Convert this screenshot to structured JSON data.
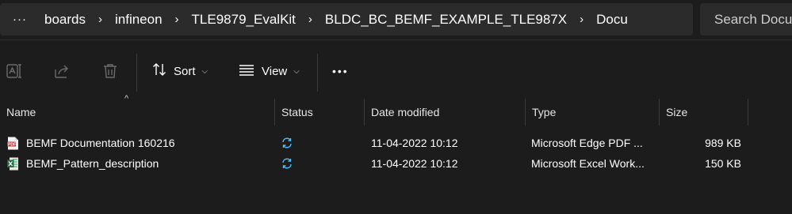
{
  "address_bar": {
    "more_label": "···",
    "breadcrumbs": [
      "boards",
      "infineon",
      "TLE9879_EvalKit",
      "BLDC_BC_BEMF_EXAMPLE_TLE987X",
      "Docu"
    ],
    "separator": "›",
    "search_placeholder": "Search Docu"
  },
  "toolbar": {
    "rename_icon": "rename-icon",
    "share_icon": "share-icon",
    "delete_icon": "trash-icon",
    "sort_label": "Sort",
    "view_label": "View",
    "more_label": "•••"
  },
  "columns": {
    "name": "Name",
    "status": "Status",
    "date_modified": "Date modified",
    "type": "Type",
    "size": "Size"
  },
  "files": [
    {
      "name": "BEMF Documentation 160216",
      "icon": "pdf-file-icon",
      "status_icon": "sync-icon",
      "date": "11-04-2022 10:12",
      "type": "Microsoft Edge PDF ...",
      "size": "989 KB"
    },
    {
      "name": "BEMF_Pattern_description",
      "icon": "excel-file-icon",
      "status_icon": "sync-icon",
      "date": "11-04-2022 10:12",
      "type": "Microsoft Excel Work...",
      "size": "150 KB"
    }
  ],
  "colors": {
    "background": "#1c1c1c",
    "accent": "#4cc2ff",
    "pdf": "#d13438",
    "excel": "#1d6f42"
  }
}
